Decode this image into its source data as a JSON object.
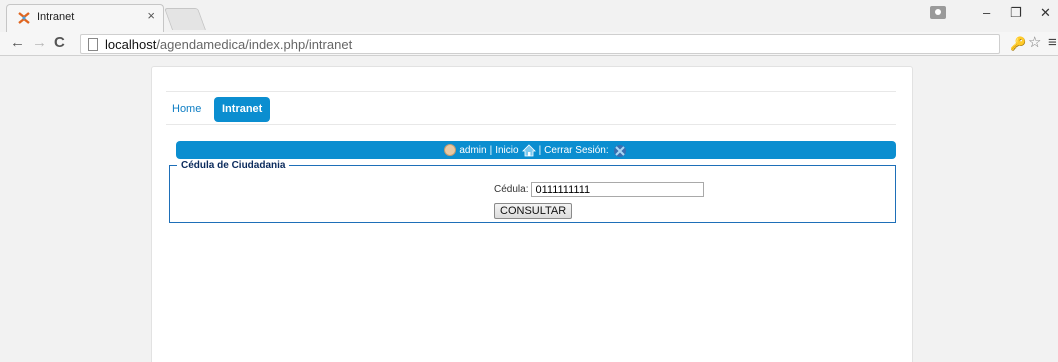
{
  "browser": {
    "tab_title": "Intranet",
    "tab_close": "×",
    "url_host": "localhost",
    "url_path": "/agendamedica/index.php/intranet",
    "window_min": "–",
    "window_max": "❐",
    "window_close": "✕",
    "nav_back": "←",
    "nav_forward": "→",
    "nav_reload": "C",
    "key_icon": "🔑",
    "star_icon": "☆",
    "menu_icon": "≡"
  },
  "nav": {
    "home_label": "Home",
    "intranet_label": "Intranet"
  },
  "userbar": {
    "username": "admin",
    "separator1": "|",
    "inicio_label": "Inicio",
    "separator2": "|",
    "cerrar_label": "Cerrar Sesión:"
  },
  "form": {
    "legend": "Cédula de Ciudadania",
    "cedula_label": "Cédula:",
    "cedula_value": "0111111111",
    "submit_label": "CONSULTAR"
  },
  "colors": {
    "primary_blue": "#0b8ed0",
    "fieldset_border": "#1e6fb8"
  }
}
